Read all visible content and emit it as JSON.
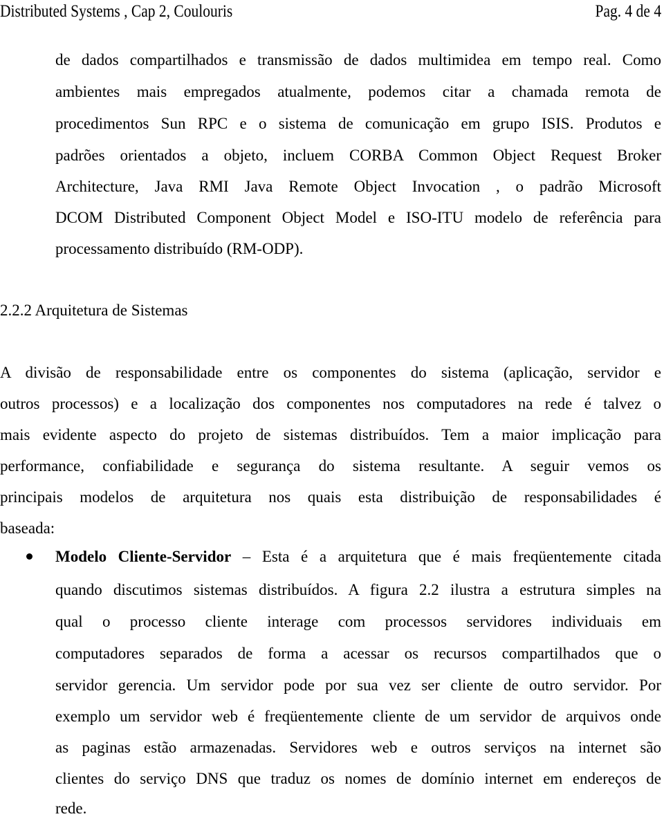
{
  "header": {
    "title": "Distributed Systems ,  Cap 2,  Coulouris",
    "page": "Pag. 4 de 4"
  },
  "paragraph1": {
    "lines": [
      "de dados compartilhados e transmissão de dados multimidea  em tempo real. Como",
      "ambientes mais empregados atualmente, podemos citar a chamada remota de",
      "procedimentos Sun RPC e o sistema de comunicação em grupo ISIS. Produtos e",
      "padrões orientados a objeto, incluem CORBA Common Object Request Broker",
      "Architecture, Java RMI Java Remote Object Invocation ,   o padrão Microsoft",
      "DCOM Distributed Component Object Model e ISO-ITU modelo de referência para",
      "processamento distribuído (RM-ODP)."
    ]
  },
  "section": {
    "heading": "2.2.2 Arquitetura de Sistemas"
  },
  "paragraph2": {
    "lines": [
      "A divisão de responsabilidade entre os componentes do sistema (aplicação, servidor e",
      "outros processos) e a localização dos componentes nos computadores na rede é talvez o",
      "mais evidente aspecto do projeto de sistemas distribuídos. Tem a maior implicação para",
      "performance, confiabilidade e segurança do sistema resultante.  A seguir vemos os",
      "principais modelos de arquitetura nos quais esta distribuição de responsabilidades é",
      "baseada:"
    ]
  },
  "bullet": {
    "term": "Modelo Cliente-Servidor",
    "first_line_rest": " – Esta é a arquitetura que é mais freqüentemente citada",
    "lines": [
      "quando discutimos sistemas distribuídos. A figura 2.2 ilustra a estrutura simples na",
      "qual o processo cliente interage com processos servidores individuais em",
      "computadores separados de forma a acessar os recursos compartilhados que o",
      "servidor gerencia. Um servidor pode por sua vez ser cliente de outro servidor. Por",
      "exemplo um servidor web é freqüentemente cliente de um servidor de arquivos onde",
      "as paginas estão armazenadas. Servidores web e outros serviços na internet são",
      "clientes do serviço DNS que traduz os nomes de domínio internet em endereços de",
      "rede."
    ]
  }
}
